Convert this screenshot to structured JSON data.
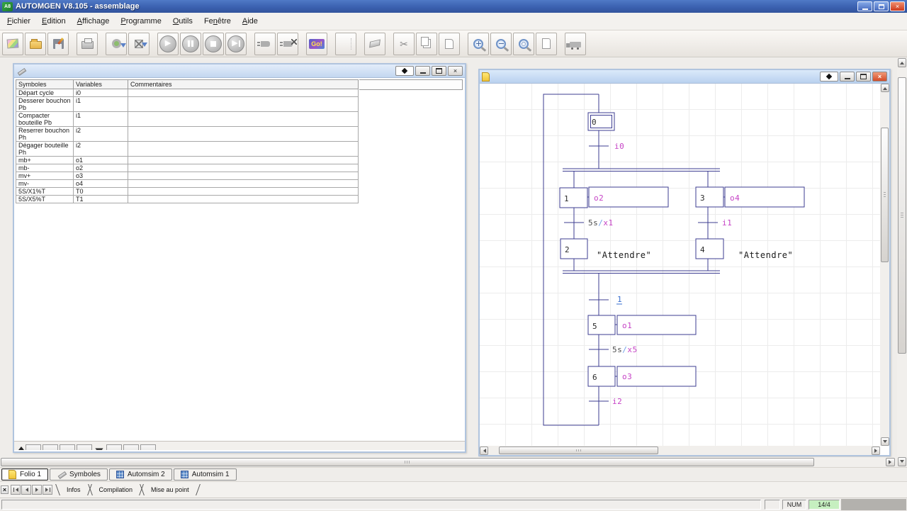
{
  "titlebar": {
    "app_icon_text": "A8",
    "title": "AUTOMGEN V8.105 - assemblage",
    "close_glyph": "×"
  },
  "menu": {
    "items": [
      {
        "pre": "",
        "key": "F",
        "post": "ichier"
      },
      {
        "pre": "",
        "key": "E",
        "post": "dition"
      },
      {
        "pre": "",
        "key": "A",
        "post": "ffichage"
      },
      {
        "pre": "",
        "key": "P",
        "post": "rogramme"
      },
      {
        "pre": "",
        "key": "O",
        "post": "utils"
      },
      {
        "pre": "Fe",
        "key": "n",
        "post": "être"
      },
      {
        "pre": "",
        "key": "A",
        "post": "ide"
      }
    ]
  },
  "toolbar": {
    "go_label": "Go!",
    "play_glyph": "▶",
    "step_glyph": "▶",
    "buttons": [
      "new-document",
      "open",
      "save",
      "print",
      "compile-download",
      "compile-stop-download",
      "play",
      "pause",
      "stop",
      "step",
      "connect",
      "disconnect",
      "go",
      "select",
      "erase",
      "cut",
      "copy",
      "paste",
      "zoom-in",
      "zoom-out",
      "zoom-fit",
      "new-folio",
      "transfer"
    ]
  },
  "symbols_window": {
    "columns": [
      "Symboles",
      "Variables",
      "Commentaires"
    ],
    "rows": [
      {
        "symbol": "Départ cycle",
        "variable": "i0",
        "comment": ""
      },
      {
        "symbol": "Desserer bouchon Pb",
        "variable": "i1",
        "comment": ""
      },
      {
        "symbol": "Compacter bouteille Pb",
        "variable": "i1",
        "comment": ""
      },
      {
        "symbol": "Reserrer bouchon Ph",
        "variable": "i2",
        "comment": ""
      },
      {
        "symbol": "Dégager bouteille Ph",
        "variable": "i2",
        "comment": ""
      },
      {
        "symbol": "mb+",
        "variable": "o1",
        "comment": ""
      },
      {
        "symbol": "mb-",
        "variable": "o2",
        "comment": ""
      },
      {
        "symbol": "mv+",
        "variable": "o3",
        "comment": ""
      },
      {
        "symbol": "mv-",
        "variable": "o4",
        "comment": ""
      },
      {
        "symbol": "5S/X1%T",
        "variable": "T0",
        "comment": ""
      },
      {
        "symbol": "5S/X5%T",
        "variable": "T1",
        "comment": ""
      }
    ]
  },
  "grafcet": {
    "steps": {
      "s0": "0",
      "s1": "1",
      "s2": "2",
      "s3": "3",
      "s4": "4",
      "s5": "5",
      "s6": "6"
    },
    "transitions": {
      "t_i0": "i0",
      "t51_time": "5s",
      "t51_slash": "/",
      "t51_var": "x1",
      "t_i1": "i1",
      "t_always": "1",
      "t55_time": "5s",
      "t55_slash": "/",
      "t55_var": "x5",
      "t_i2": "i2"
    },
    "actions": {
      "a_o2": "o2",
      "a_o4": "o4",
      "a_o1": "o1",
      "a_o3": "o3"
    },
    "comments": {
      "step2": "\"Attendre\"",
      "step4": "\"Attendre\""
    }
  },
  "doc_tabs": [
    {
      "label": "Folio 1",
      "icon": "folio-page",
      "active": true
    },
    {
      "label": "Symboles",
      "icon": "pencil",
      "active": false
    },
    {
      "label": "Automsim 2",
      "icon": "automsim-grid",
      "active": false
    },
    {
      "label": "Automsim 1",
      "icon": "automsim-grid",
      "active": false
    }
  ],
  "output_bar": {
    "close_glyph": "×",
    "nav_icons": [
      "first",
      "previous",
      "next",
      "last"
    ],
    "tabs": [
      "Infos",
      "Compilation",
      "Mise au point"
    ]
  },
  "status_bar": {
    "num": "NUM",
    "position": "14/4"
  },
  "colors": {
    "titlebar_blue": "#3f67b5",
    "diagram_line": "#3d3d92",
    "label_magenta": "#c643c6",
    "label_blue": "#3a6fd0",
    "slash_blue": "#6f9fe8",
    "status_green": "#c6efc0"
  }
}
